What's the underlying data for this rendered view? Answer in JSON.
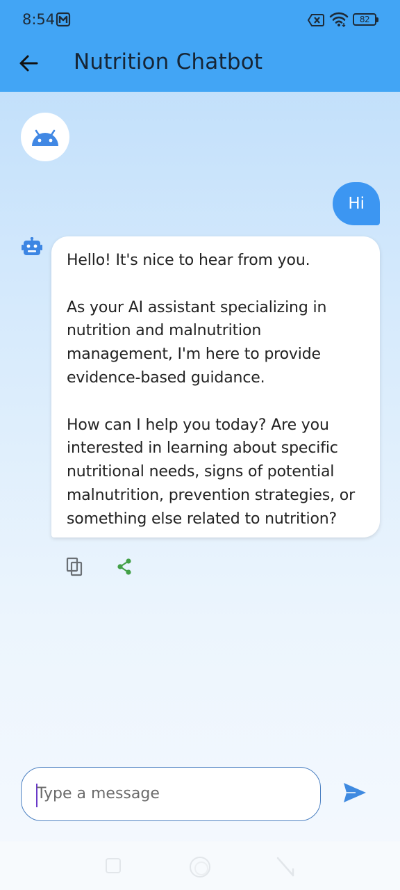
{
  "status_bar": {
    "time": "8:54",
    "battery": "82"
  },
  "header": {
    "title": "Nutrition Chatbot"
  },
  "messages": {
    "user": "Hi",
    "bot_paragraphs": [
      "Hello! It's nice to hear from you.",
      "As your AI assistant specializing in nutrition and malnutrition management, I'm here to provide evidence-based guidance.",
      "How can I help you today? Are you interested in learning about specific nutritional needs, signs of potential malnutrition, prevention strategies, or something else related to nutrition?"
    ]
  },
  "composer": {
    "placeholder": "Type a message",
    "value": ""
  },
  "icons": {
    "back": "arrow-left-icon",
    "avatar": "android-icon",
    "bot": "robot-icon",
    "copy": "copy-icon",
    "share": "share-icon",
    "send": "send-icon"
  },
  "colors": {
    "app_bar": "#42a5f5",
    "user_bubble": "#3c96f2",
    "send_icon": "#3f8ae0",
    "share_icon": "#43a047",
    "input_border": "#4a7fc1"
  }
}
